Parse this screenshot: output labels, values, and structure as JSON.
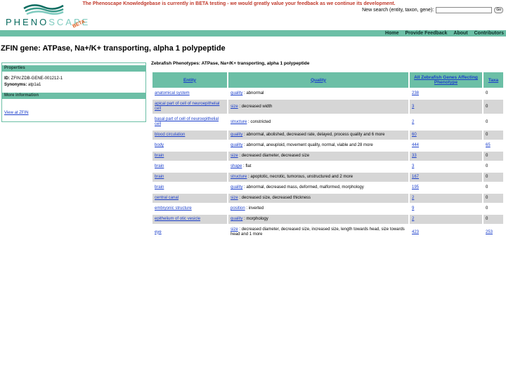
{
  "header": {
    "beta_notice": "The Phenoscape Knowledgebase is currently in BETA testing - we would greatly value your feedback as we continue its development.",
    "logo": {
      "pheno": "PHENO",
      "scape": "SCAPE",
      "beta": "BETA"
    },
    "search": {
      "label": "New search (entity, taxon, gene):",
      "value": "",
      "button": "Go"
    }
  },
  "nav": {
    "items": [
      "Home",
      "Provide Feedback",
      "About",
      "Contributors"
    ]
  },
  "page_title": "ZFIN gene: ATPase, Na+/K+ transporting, alpha 1 polypeptide",
  "sidebar": {
    "properties_heading": "Properties",
    "id_label": "ID:",
    "id_value": "ZFIN:ZDB-GENE-001212-1",
    "synonyms_label": "Synonyms:",
    "synonyms_value": "atp1a1",
    "more_heading": "More information",
    "link": "View at ZFIN"
  },
  "main": {
    "heading": "Zebrafish Phenotypes: ATPase, Na+/K+ transporting, alpha 1 polypeptide",
    "columns": [
      "Entity",
      "Quality",
      "All Zebrafish Genes Affecting Phenotype",
      "Taxa"
    ],
    "rows": [
      {
        "entity": "anatomical system",
        "q_link": "quality",
        "q_text": " : abnormal",
        "genes": "238",
        "taxa": "0"
      },
      {
        "entity": "apical part of cell of neuroepithelial cell",
        "q_link": "size",
        "q_text": " : decreased width",
        "genes": "3",
        "taxa": "0"
      },
      {
        "entity": "basal part of cell of neuroepithelial cell",
        "q_link": "structure",
        "q_text": " : constricted",
        "genes": "2",
        "taxa": "0"
      },
      {
        "entity": "blood circulation",
        "q_link": "quality",
        "q_text": " : abnormal, abolished, decreased rate, delayed, process quality and 6 more",
        "genes": "60",
        "taxa": "0"
      },
      {
        "entity": "body",
        "q_link": "quality",
        "q_text": " : abnormal, aneuploid, movement quality, normal, viable and 28 more",
        "genes": "444",
        "taxa": "65"
      },
      {
        "entity": "brain",
        "q_link": "size",
        "q_text": " : decreased diameter, decreased size",
        "genes": "33",
        "taxa": "0"
      },
      {
        "entity": "brain",
        "q_link": "shape",
        "q_text": " : flat",
        "genes": "3",
        "taxa": "0"
      },
      {
        "entity": "brain",
        "q_link": "structure",
        "q_text": " : apoptotic, necrotic, tumorous, unstructured and 2 more",
        "genes": "167",
        "taxa": "0"
      },
      {
        "entity": "brain",
        "q_link": "quality",
        "q_text": " : abnormal, decreased mass, deformed, malformed, morphology",
        "genes": "195",
        "taxa": "0"
      },
      {
        "entity": "central canal",
        "q_link": "size",
        "q_text": " : decreased size, decreased thickness",
        "genes": "2",
        "taxa": "0"
      },
      {
        "entity": "embryonic structure",
        "q_link": "position",
        "q_text": " : inverted",
        "genes": "9",
        "taxa": "0"
      },
      {
        "entity": "epithelium of otic vesicle",
        "q_link": "quality",
        "q_text": " : morphology",
        "genes": "2",
        "taxa": "0"
      },
      {
        "entity": "eye",
        "q_link": "size",
        "q_text": " : decreased diameter, decreased size, increased size, length towards head, size towards head and 1 more",
        "genes": "423",
        "taxa": "253"
      }
    ]
  },
  "colors": {
    "accent": "#6cbfa6",
    "link": "#1a3ecb",
    "alert": "#c0392b",
    "logo_dark": "#0a6b5f",
    "logo_light": "#7fcbbf",
    "beta": "#e05a1a",
    "row_alt": "#d6d6d6"
  }
}
